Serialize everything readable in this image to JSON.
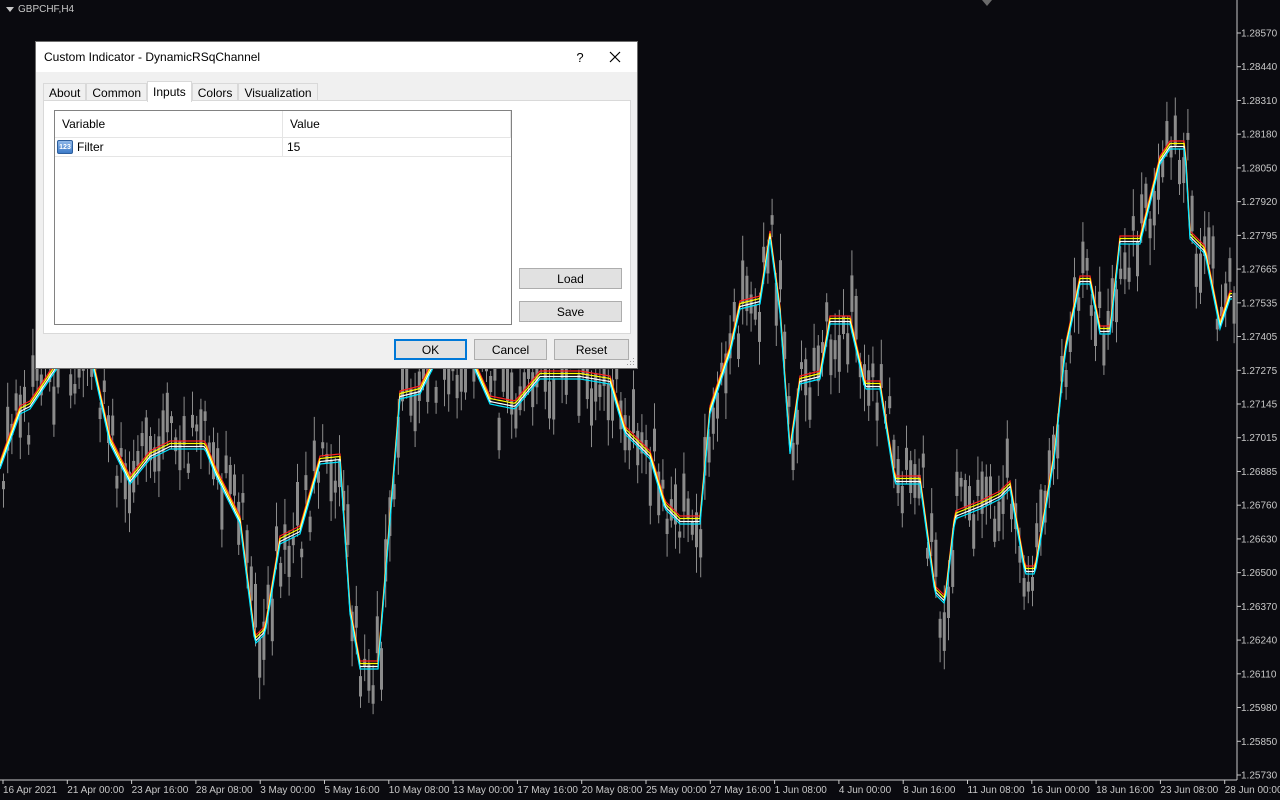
{
  "chart": {
    "symbol_label": "GBPCHF,H4",
    "price_labels": [
      "1.28570",
      "1.28440",
      "1.28310",
      "1.28180",
      "1.28050",
      "1.27920",
      "1.27795",
      "1.27665",
      "1.27535",
      "1.27405",
      "1.27275",
      "1.27145",
      "1.27015",
      "1.26885",
      "1.26760",
      "1.26630",
      "1.26500",
      "1.26370",
      "1.26240",
      "1.26110",
      "1.25980",
      "1.25850",
      "1.25730"
    ],
    "time_labels": [
      "16 Apr 2021",
      "21 Apr 00:00",
      "23 Apr 16:00",
      "28 Apr 08:00",
      "3 May 00:00",
      "5 May 16:00",
      "10 May 08:00",
      "13 May 00:00",
      "17 May 16:00",
      "20 May 08:00",
      "25 May 00:00",
      "27 May 16:00",
      "1 Jun 08:00",
      "4 Jun 00:00",
      "8 Jun 16:00",
      "11 Jun 08:00",
      "16 Jun 00:00",
      "18 Jun 16:00",
      "23 Jun 08:00",
      "28 Jun 00:00"
    ],
    "colors": {
      "background": "#0a0a0f",
      "candle": "#8c8c8c",
      "channel_upper": "#ff2020",
      "channel_mid": "#ffff00",
      "channel_lower1": "#ffffff",
      "channel_lower2": "#00e5ff"
    }
  },
  "dialog": {
    "title": "Custom Indicator - DynamicRSqChannel",
    "help_label": "?",
    "tabs": [
      {
        "label": "About"
      },
      {
        "label": "Common"
      },
      {
        "label": "Inputs"
      },
      {
        "label": "Colors"
      },
      {
        "label": "Visualization"
      }
    ],
    "active_tab": "Inputs",
    "grid": {
      "col_variable": "Variable",
      "col_value": "Value",
      "rows": [
        {
          "icon": "number-icon",
          "icon_text": "123",
          "variable": "Filter",
          "value": "15"
        }
      ]
    },
    "load_label": "Load",
    "save_label": "Save",
    "ok_label": "OK",
    "cancel_label": "Cancel",
    "reset_label": "Reset"
  }
}
